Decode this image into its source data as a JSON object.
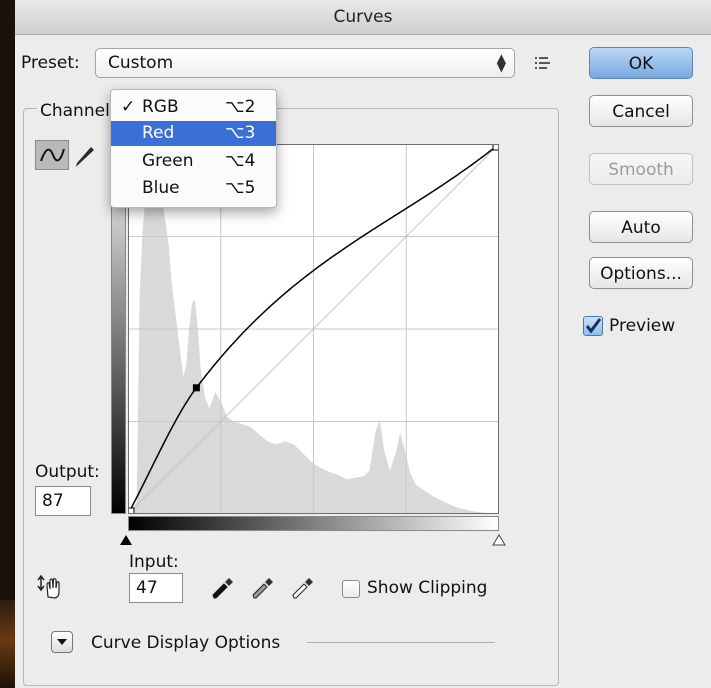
{
  "window": {
    "title": "Curves"
  },
  "preset": {
    "label": "Preset:",
    "value": "Custom",
    "menu_icon": "preset-options-icon"
  },
  "buttons": {
    "ok": "OK",
    "cancel": "Cancel",
    "smooth": "Smooth",
    "auto": "Auto",
    "options": "Options..."
  },
  "preview": {
    "label": "Preview",
    "checked": true
  },
  "channel": {
    "label": "Channel:",
    "menu": [
      {
        "check": "✓",
        "name": "RGB",
        "shortcut": "⌥2"
      },
      {
        "check": "",
        "name": "Red",
        "shortcut": "⌥3",
        "selected": true
      },
      {
        "check": "",
        "name": "Green",
        "shortcut": "⌥4"
      },
      {
        "check": "",
        "name": "Blue",
        "shortcut": "⌥5"
      }
    ]
  },
  "output": {
    "label": "Output:",
    "value": "87"
  },
  "input": {
    "label": "Input:",
    "value": "47"
  },
  "show_clipping": {
    "label": "Show Clipping",
    "checked": false
  },
  "curve_display_options": {
    "label": "Curve Display Options"
  },
  "curve": {
    "points": [
      [
        0,
        0
      ],
      [
        47,
        87
      ],
      [
        255,
        255
      ]
    ],
    "selected_point": [
      47,
      87
    ]
  },
  "histogram": [
    [
      0,
      0
    ],
    [
      6,
      8
    ],
    [
      8,
      150
    ],
    [
      10,
      195
    ],
    [
      13,
      230
    ],
    [
      16,
      255
    ],
    [
      19,
      255
    ],
    [
      22,
      225
    ],
    [
      26,
      200
    ],
    [
      28,
      185
    ],
    [
      30,
      160
    ],
    [
      33,
      135
    ],
    [
      36,
      110
    ],
    [
      38,
      95
    ],
    [
      40,
      102
    ],
    [
      42,
      128
    ],
    [
      44,
      145
    ],
    [
      46,
      148
    ],
    [
      48,
      128
    ],
    [
      50,
      100
    ],
    [
      53,
      80
    ],
    [
      56,
      73
    ],
    [
      60,
      84
    ],
    [
      64,
      77
    ],
    [
      68,
      67
    ],
    [
      72,
      64
    ],
    [
      78,
      62
    ],
    [
      84,
      60
    ],
    [
      90,
      55
    ],
    [
      96,
      50
    ],
    [
      102,
      48
    ],
    [
      108,
      50
    ],
    [
      114,
      48
    ],
    [
      120,
      42
    ],
    [
      126,
      36
    ],
    [
      132,
      32
    ],
    [
      138,
      29
    ],
    [
      144,
      27
    ],
    [
      150,
      24
    ],
    [
      156,
      25
    ],
    [
      162,
      26
    ],
    [
      166,
      30
    ],
    [
      170,
      56
    ],
    [
      173,
      65
    ],
    [
      176,
      44
    ],
    [
      180,
      30
    ],
    [
      184,
      42
    ],
    [
      187,
      56
    ],
    [
      190,
      45
    ],
    [
      194,
      28
    ],
    [
      198,
      20
    ],
    [
      204,
      16
    ],
    [
      210,
      12
    ],
    [
      216,
      9
    ],
    [
      222,
      6
    ],
    [
      228,
      4
    ],
    [
      236,
      2
    ],
    [
      244,
      1
    ],
    [
      255,
      0
    ]
  ],
  "colors": {
    "accent": "#3a6fd8",
    "ok_button": "#76a8df",
    "histogram": "#d9d9d9"
  }
}
